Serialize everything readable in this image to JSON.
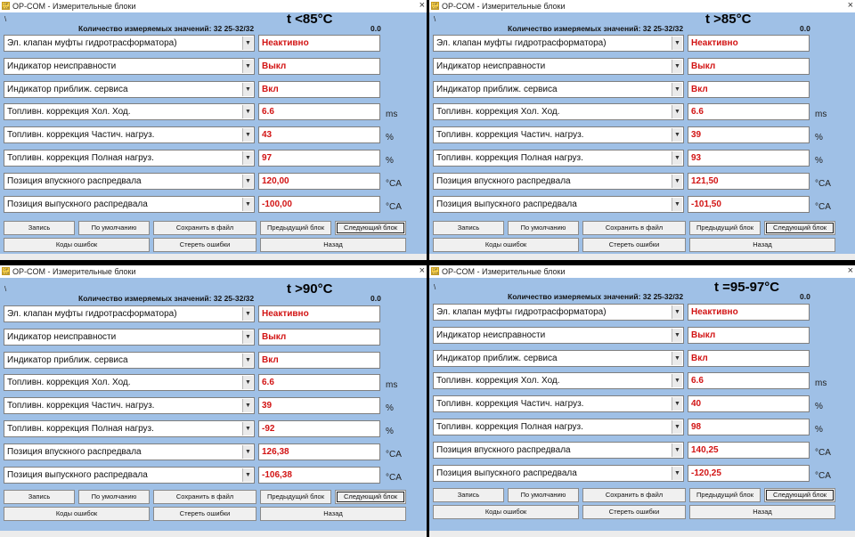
{
  "app": {
    "title": "OP-COM - Измерительные блоки",
    "icon_text": "OP COM",
    "close_glyph": "×",
    "header_mark": "\\",
    "header_label": "Количество измеряемых значений: 32  25-32/32",
    "header_value": "0.0"
  },
  "rows": {
    "labels": [
      "Эл. клапан муфты гидротрасформатора)",
      "Индикатор неисправности",
      "Индикатор приближ. сервиса",
      "Топливн. коррекция Хол. Ход.",
      "Топливн. коррекция Частич. нагруз.",
      "Топливн. коррекция Полная нагруз.",
      "Позиция впускного распредвала",
      "Позиция выпускного распредвала"
    ],
    "units": [
      "",
      "",
      "",
      "ms",
      "%",
      "%",
      "°CA",
      "°CA"
    ]
  },
  "buttons": {
    "record": "Запись",
    "default": "По умолчанию",
    "save": "Сохранить в файл",
    "prev": "Предыдущий блок",
    "next": "Следующий блок",
    "errors": "Коды ошибок",
    "clear": "Стереть ошибки",
    "back": "Назад"
  },
  "panels": [
    {
      "temp_label": "t <85°C",
      "values": [
        "Неактивно",
        "Выкл",
        "Вкл",
        "6.6",
        "43",
        "97",
        "120,00",
        "-100,00"
      ]
    },
    {
      "temp_label": "t >85°C",
      "values": [
        "Неактивно",
        "Выкл",
        "Вкл",
        "6.6",
        "39",
        "93",
        "121,50",
        "-101,50"
      ]
    },
    {
      "temp_label": "t >90°C",
      "values": [
        "Неактивно",
        "Выкл",
        "Вкл",
        "6.6",
        "39",
        "-92",
        "126,38",
        "-106,38"
      ]
    },
    {
      "temp_label": "t =95-97°C",
      "values": [
        "Неактивно",
        "Выкл",
        "Вкл",
        "6.6",
        "40",
        "98",
        "140,25",
        "-120,25"
      ]
    }
  ],
  "colors": {
    "window_bg": "#9fc0e6",
    "value_red": "#d21414",
    "divider": "#000000"
  }
}
